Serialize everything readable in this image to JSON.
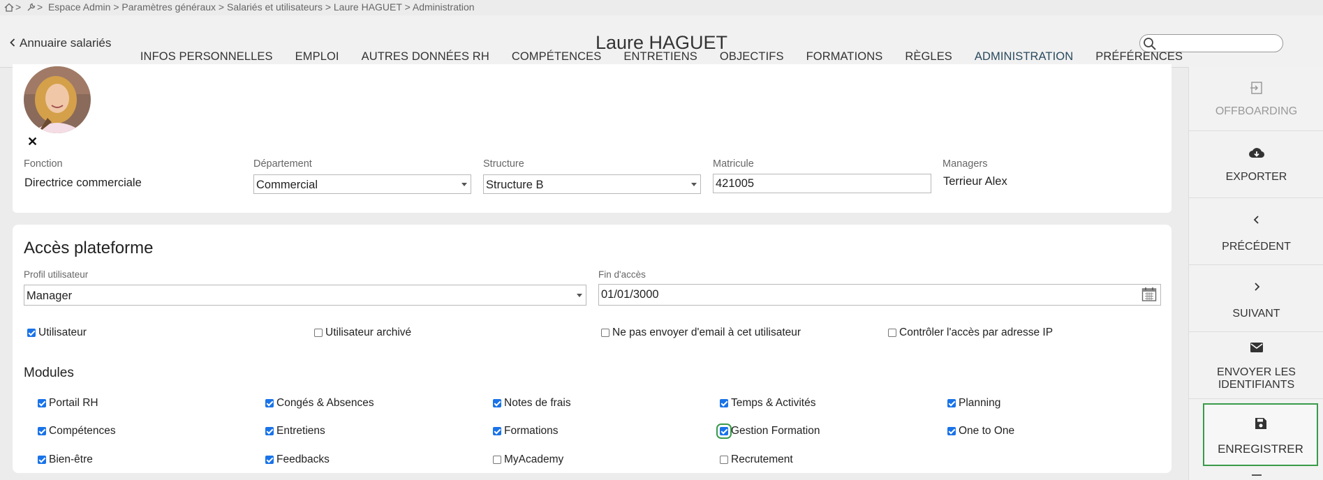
{
  "breadcrumb": {
    "text": ">  Espace Admin > Paramètres généraux > Salariés et utilisateurs > Laure HAGUET > Administration",
    "separator": ">"
  },
  "header": {
    "back_label": "Annuaire salariés",
    "title": "Laure HAGUET",
    "search": {
      "value": "",
      "placeholder": ""
    }
  },
  "tabs": [
    {
      "label": "INFOS PERSONNELLES"
    },
    {
      "label": "EMPLOI"
    },
    {
      "label": "AUTRES DONNÉES RH"
    },
    {
      "label": "COMPÉTENCES"
    },
    {
      "label": "ENTRETIENS"
    },
    {
      "label": "OBJECTIFS"
    },
    {
      "label": "FORMATIONS"
    },
    {
      "label": "RÈGLES"
    },
    {
      "label": "ADMINISTRATION",
      "active": true
    },
    {
      "label": "PRÉFÉRENCES"
    }
  ],
  "profile": {
    "remove_glyph": "✕",
    "fonction": {
      "label": "Fonction",
      "value": "Directrice commerciale"
    },
    "departement": {
      "label": "Département",
      "value": "Commercial"
    },
    "structure": {
      "label": "Structure",
      "value": "Structure B"
    },
    "matricule": {
      "label": "Matricule",
      "value": "421005"
    },
    "managers": {
      "label": "Managers",
      "value": "Terrieur Alex"
    }
  },
  "access": {
    "title": "Accès plateforme",
    "profil": {
      "label": "Profil utilisateur",
      "value": "Manager"
    },
    "fin_acces": {
      "label": "Fin d'accès",
      "value": "01/01/3000"
    },
    "options": [
      {
        "label": "Utilisateur",
        "checked": true
      },
      {
        "label": "Utilisateur archivé",
        "checked": false
      },
      {
        "label": "Ne pas envoyer d'email à cet utilisateur",
        "checked": false
      },
      {
        "label": "Contrôler l'accès par adresse IP",
        "checked": false
      }
    ],
    "modules_title": "Modules",
    "modules": [
      {
        "label": "Portail RH",
        "checked": true
      },
      {
        "label": "Congés & Absences",
        "checked": true
      },
      {
        "label": "Notes de frais",
        "checked": true
      },
      {
        "label": "Temps & Activités",
        "checked": true
      },
      {
        "label": "Planning",
        "checked": true
      },
      {
        "label": "Compétences",
        "checked": true
      },
      {
        "label": "Entretiens",
        "checked": true
      },
      {
        "label": "Formations",
        "checked": true
      },
      {
        "label": "Gestion Formation",
        "checked": true,
        "focused": true
      },
      {
        "label": "One to One",
        "checked": true
      },
      {
        "label": "Bien-être",
        "checked": true
      },
      {
        "label": "Feedbacks",
        "checked": true
      },
      {
        "label": "MyAcademy",
        "checked": false
      },
      {
        "label": "Recrutement",
        "checked": false
      }
    ]
  },
  "side_actions": [
    {
      "label": "OFFBOARDING",
      "icon": "offboarding-icon",
      "disabled": true
    },
    {
      "label": "EXPORTER",
      "icon": "cloud-download-icon"
    },
    {
      "label": "PRÉCÉDENT",
      "icon": "chevron-left-icon"
    },
    {
      "label": "SUIVANT",
      "icon": "chevron-right-icon"
    },
    {
      "label": "ENVOYER LES IDENTIFIANTS",
      "icon": "mail-icon"
    },
    {
      "label": "ENREGISTRER",
      "icon": "save-icon",
      "primary": true
    }
  ],
  "colors": {
    "accent": "#2a4a5e",
    "checkbox": "#1a73e8",
    "focus": "#3a9a4a"
  }
}
